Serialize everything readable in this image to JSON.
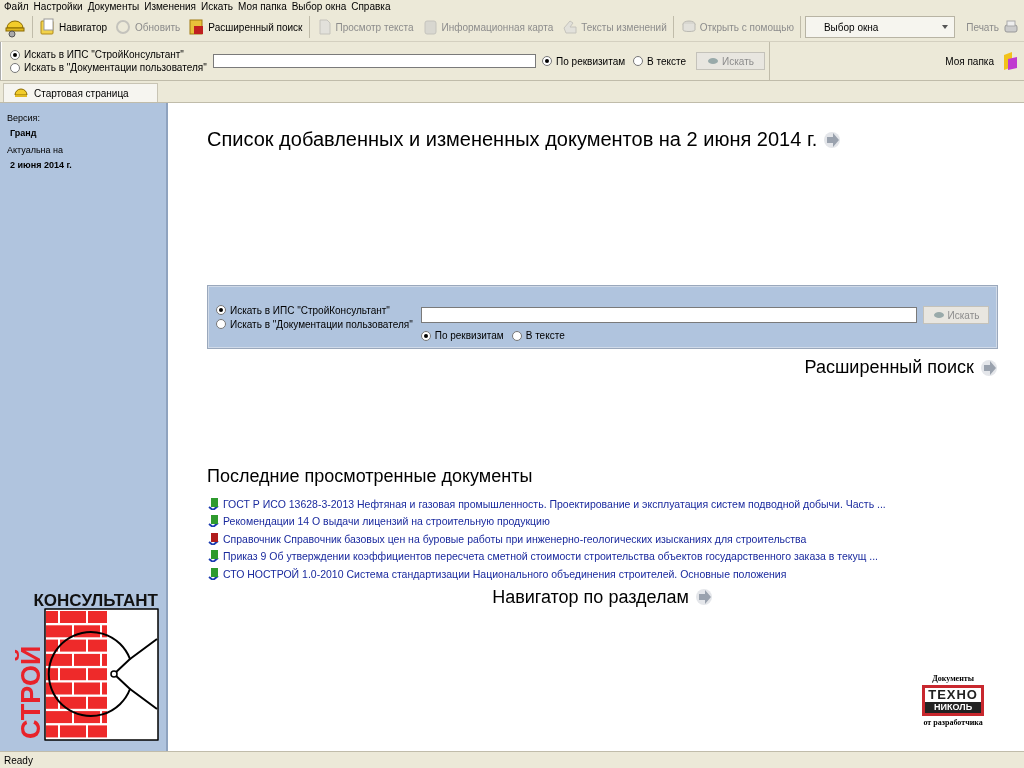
{
  "menu": [
    "Файл",
    "Настройки",
    "Документы",
    "Изменения",
    "Искать",
    "Моя папка",
    "Выбор окна",
    "Справка"
  ],
  "toolbar": {
    "items": [
      {
        "kind": "navigator",
        "label": "Навигатор",
        "disabled": false
      },
      {
        "kind": "refresh",
        "label": "Обновить",
        "disabled": true
      },
      {
        "kind": "search",
        "label": "Расширенный поиск",
        "disabled": false
      },
      {
        "kind": "text",
        "label": "Просмотр текста",
        "disabled": true
      },
      {
        "kind": "card",
        "label": "Информационная карта",
        "disabled": true
      },
      {
        "kind": "changes",
        "label": "Тексты изменений",
        "disabled": true
      },
      {
        "kind": "open",
        "label": "Открыть с помощью",
        "disabled": true
      }
    ],
    "window_select": {
      "value": "Выбор окна"
    },
    "print": {
      "label": "Печать",
      "disabled": true
    }
  },
  "search_bar": {
    "sources": [
      {
        "label": "Искать в ИПС \"СтройКонсультант\"",
        "selected": true
      },
      {
        "label": "Искать в \"Документации пользователя\"",
        "selected": false
      }
    ],
    "modes": [
      {
        "label": "По реквизитам",
        "selected": true
      },
      {
        "label": "В тексте",
        "selected": false
      }
    ],
    "button": {
      "label": "Искать",
      "disabled": true
    },
    "my_folder": "Моя папка"
  },
  "tabs": [
    {
      "label": "Стартовая страница",
      "selected": true
    }
  ],
  "sidebar": {
    "version_label": "Версия:",
    "version": "Гранд",
    "date_label": "Актуальна на",
    "date": "2 июня 2014 г.",
    "logo": {
      "top": "КОНСУЛЬТАНТ",
      "side": "СТРОЙ"
    }
  },
  "content": {
    "updates_title": "Список добавленных и измененных документов на 2 июня 2014 г.",
    "search_panel": {
      "sources": [
        {
          "label": "Искать в ИПС \"СтройКонсультант\"",
          "selected": true
        },
        {
          "label": "Искать в \"Документации пользователя\"",
          "selected": false
        }
      ],
      "modes": [
        {
          "label": "По реквизитам",
          "selected": true
        },
        {
          "label": "В тексте",
          "selected": false
        }
      ],
      "button": {
        "label": "Искать",
        "disabled": true
      }
    },
    "advanced_search": "Расширенный поиск",
    "recent_title": "Последние просмотренные документы",
    "recent_docs": [
      {
        "title": "ГОСТ Р ИСО 13628-3-2013 Нефтяная и газовая промышленность. Проектирование и эксплуатация систем подводной добычи. Часть ...",
        "color": "#2e9a2e"
      },
      {
        "title": "Рекомендации 14 О выдачи лицензий на строительную продукцию",
        "color": "#2e9a2e"
      },
      {
        "title": "Справочник Справочник базовых цен на буровые работы при инженерно-геологических изысканиях для строительства",
        "color": "#b01c1c"
      },
      {
        "title": "Приказ 9 Об утверждении коэффициентов пересчета сметной стоимости строительства объектов государственного заказа в текущ ...",
        "color": "#2e9a2e"
      },
      {
        "title": "СТО НОСТРОЙ 1.0-2010 Система стандартизации Национального объединения строителей. Основные положения",
        "color": "#2e9a2e"
      }
    ],
    "navigator": "Навигатор по разделам",
    "partner": {
      "top": "Документы",
      "brand_1": "ТЕХНО",
      "brand_2": "НИКОЛЬ",
      "bottom": "от разработчика"
    }
  },
  "status_bar": "Ready"
}
